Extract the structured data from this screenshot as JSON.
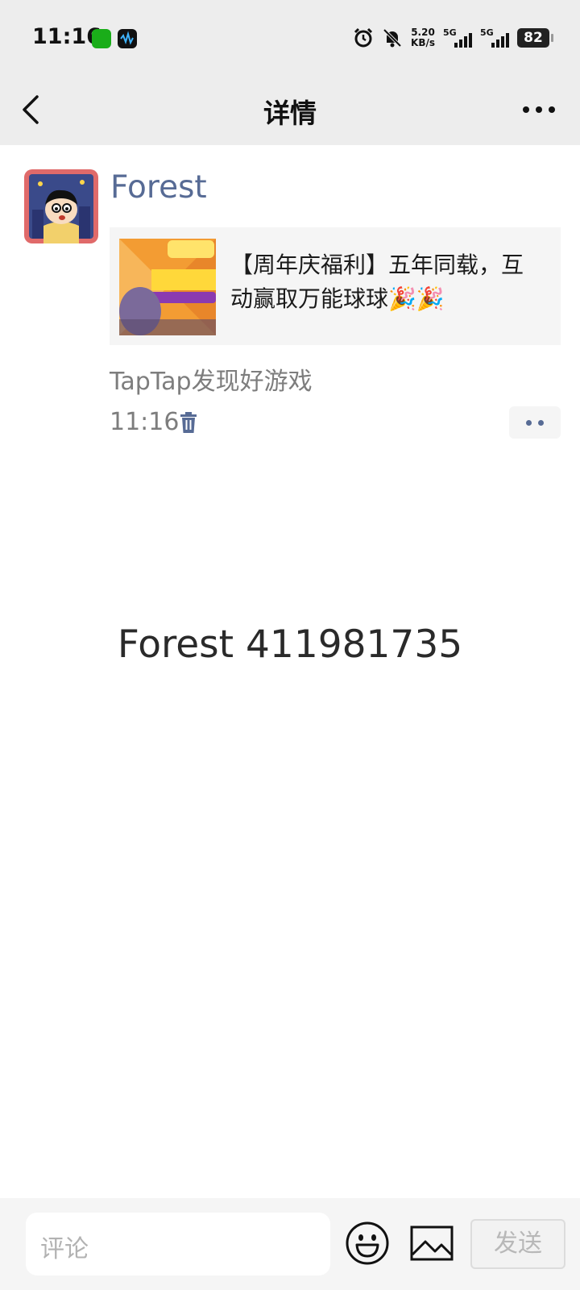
{
  "status_bar": {
    "time": "11:16",
    "net_speed_value": "5.20",
    "net_speed_unit": "KB/s",
    "network_1": "5G",
    "network_2": "5G",
    "battery": "82"
  },
  "nav": {
    "title": "详情"
  },
  "post": {
    "author": "Forest",
    "link_title": "【周年庆福利】五年同载，互动赢取万能球球🎉🎉",
    "source": "TapTap发现好游戏",
    "time": "11:16"
  },
  "watermark": "Forest 411981735",
  "input_bar": {
    "placeholder": "评论",
    "send_label": "发送"
  },
  "colors": {
    "accent_name": "#576b95",
    "bar_bg": "#ededed",
    "wechat_green": "#1aad19"
  }
}
